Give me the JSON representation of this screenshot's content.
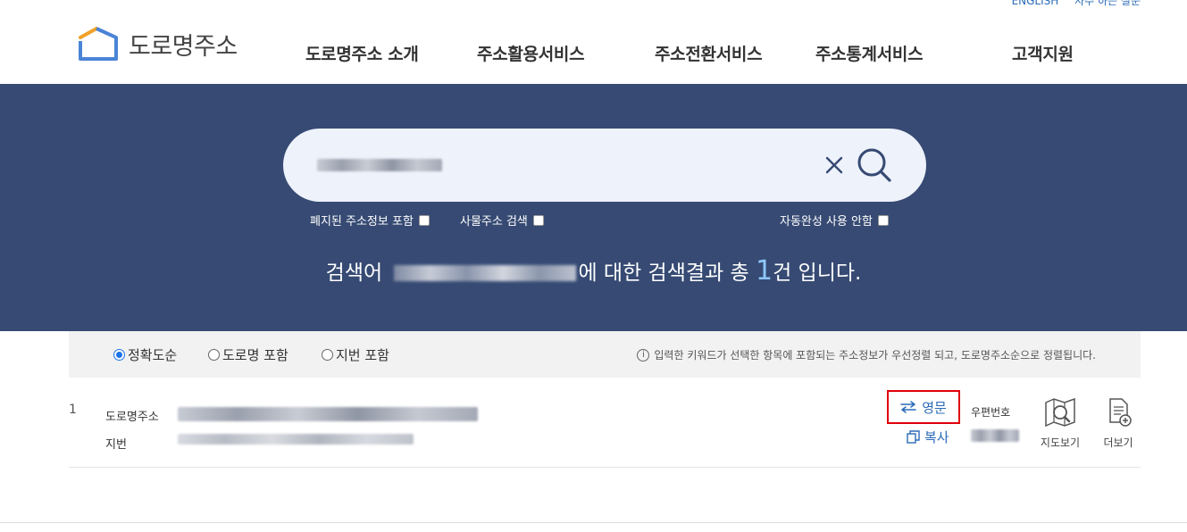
{
  "header": {
    "top_links": [
      "ENGLISH",
      "자주 하는 질문"
    ],
    "logo_text": "도로명주소",
    "nav": [
      "도로명주소 소개",
      "주소활용서비스",
      "주소전환서비스",
      "주소통계서비스",
      "고객지원"
    ]
  },
  "search": {
    "placeholder": "",
    "options": {
      "abolished": "폐지된 주소정보 포함",
      "thing_address": "사물주소 검색",
      "autocomplete_off": "자동완성 사용 안함"
    },
    "result_prefix": "검색어",
    "result_middle": "에 대한 검색결과 총",
    "result_count": "1",
    "result_suffix": "건 입니다."
  },
  "sort": {
    "options": [
      "정확도순",
      "도로명 포함",
      "지번 포함"
    ],
    "selected": "정확도순",
    "info_icon_glyph": "i",
    "info_text": "입력한 키워드가 선택한 항목에 포함되는 주소정보가 우선정렬 되고, 도로명주소순으로 정렬됩니다."
  },
  "results": [
    {
      "index": "1",
      "road_label": "도로명주소",
      "jibun_label": "지번",
      "english_label": "영문",
      "copy_label": "복사",
      "zip_label": "우편번호",
      "map_label": "지도보기",
      "more_label": "더보기"
    }
  ],
  "colors": {
    "hero": "#364a73",
    "accent_blue": "#2a6bb7",
    "highlight_red": "#e0000b",
    "count": "#8ec8ff"
  },
  "icons": {
    "clear": "close-icon",
    "search": "search-icon",
    "english": "swap-arrows-icon",
    "copy": "copy-icon",
    "map": "map-search-icon",
    "more": "document-plus-icon"
  }
}
